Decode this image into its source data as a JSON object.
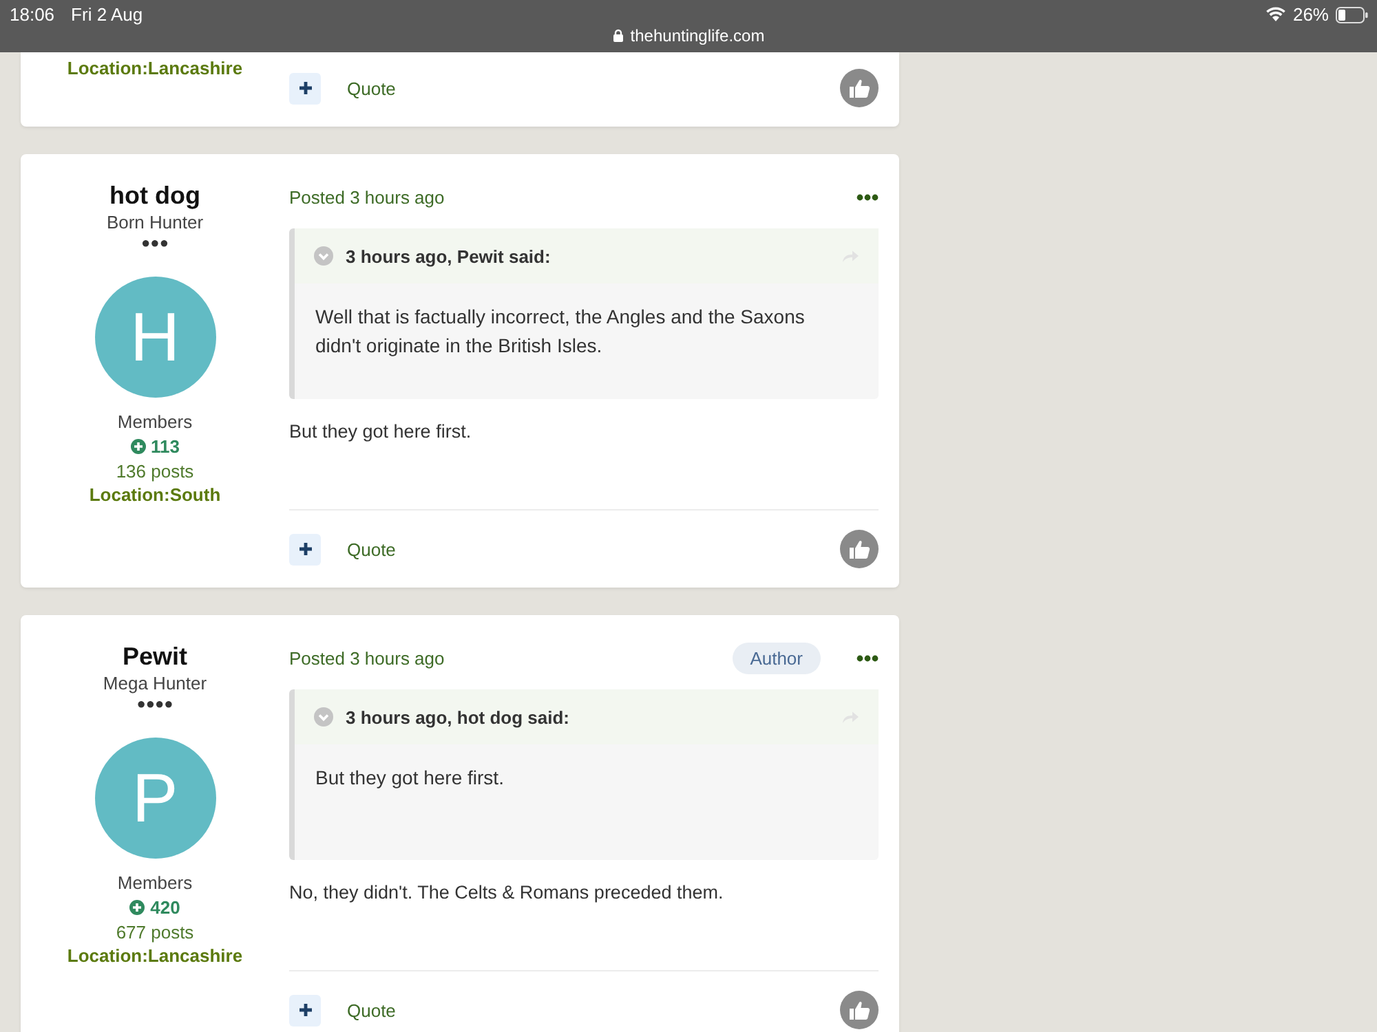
{
  "status_bar": {
    "time": "18:06",
    "date": "Fri 2 Aug",
    "url": "thehuntinglife.com",
    "battery": "26%"
  },
  "posts": [
    {
      "kind": "partial",
      "location": "Location:Lancashire",
      "quote_label": "Quote"
    },
    {
      "kind": "full",
      "name": "hot dog",
      "rank": "Born Hunter",
      "pips": "●●●",
      "avatar_letter": "H",
      "group": "Members",
      "reputation": "113",
      "post_count": "136 posts",
      "location": "Location:South",
      "posted": "Posted 3 hours ago",
      "quote": {
        "cite": "3 hours ago, Pewit said:",
        "text": "Well that is factually incorrect, the Angles and the Saxons didn't originate in the British Isles."
      },
      "body": "But they got here first.",
      "quote_label": "Quote"
    },
    {
      "kind": "full",
      "name": "Pewit",
      "rank": "Mega Hunter",
      "pips": "●●●●",
      "avatar_letter": "P",
      "group": "Members",
      "reputation": "420",
      "post_count": "677 posts",
      "location": "Location:Lancashire",
      "posted": "Posted 3 hours ago",
      "author_badge": "Author",
      "quote": {
        "cite": "3 hours ago, hot dog said:",
        "text": "But they got here first."
      },
      "body": "No, they didn't. The Celts & Romans preceded them.",
      "quote_label": "Quote"
    }
  ]
}
